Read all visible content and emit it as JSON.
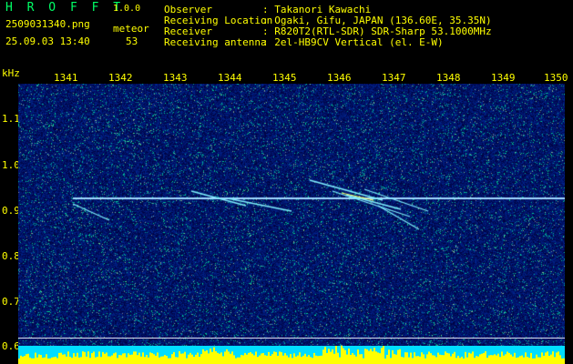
{
  "app": {
    "title": "H R O F F T",
    "version": "1.0.0"
  },
  "file": {
    "name": "2509031340.png",
    "datetime": "25.09.03 13:40"
  },
  "counter": {
    "label": "meteor",
    "value": "53"
  },
  "info": [
    {
      "key": "Observer",
      "value": ": Takanori Kawachi"
    },
    {
      "key": "Receiving Location",
      "value": ": Ogaki, Gifu, JAPAN (136.60E, 35.35N)"
    },
    {
      "key": "Receiver",
      "value": ": R820T2(RTL-SDR) SDR-Sharp 53.1000MHz"
    },
    {
      "key": "Receiving antenna",
      "value": ": 2el-HB9CV Vertical (el. E-W)"
    }
  ],
  "axes": {
    "y_unit": "kHz",
    "x_ticks": [
      "1341",
      "1342",
      "1343",
      "1344",
      "1345",
      "1346",
      "1347",
      "1348",
      "1349",
      "1350"
    ],
    "y_ticks": [
      "1.1",
      "1.0",
      "0.9",
      "0.8",
      "0.7",
      "0.6"
    ]
  },
  "colors": {
    "label": "#ffff00",
    "title": "#00ff66",
    "bg": "#001a6e",
    "carrier": "#9fd8ff"
  }
}
